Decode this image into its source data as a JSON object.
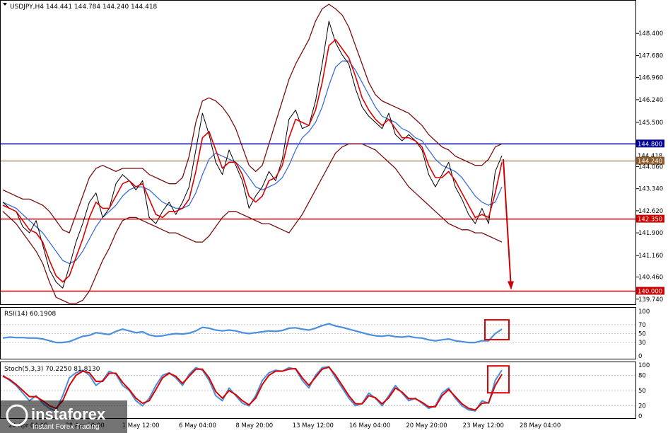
{
  "header": {
    "main": "USDJPY,H4  144.441 144.784 144.240 144.418",
    "rsi": "RSI(14) 60.1908",
    "stoch": "Stoch(5,3,3) 70.2250 81.8130"
  },
  "colors": {
    "price": "#000000",
    "ma_fast": "#dd0000",
    "ma_slow": "#3b6fd9",
    "bollinger": "#7a0f0f",
    "resistance": "#000099",
    "support": "#cc0000",
    "current": "#8b5a2b",
    "oscillator_blue": "#4a8fdc",
    "oscillator_red": "#dd0000",
    "highlight_box": "#dd0000"
  },
  "chart_data": [
    {
      "type": "line",
      "name": "USDJPY H4 price",
      "y_range": [
        139.62,
        149.35
      ],
      "y_ticks": [
        "148.400",
        "147.680",
        "146.960",
        "146.240",
        "145.500",
        "144.060",
        "143.340",
        "142.620",
        "141.900",
        "141.160",
        "140.460",
        "139.740"
      ],
      "x_labels": [
        "24 Apr 04:00",
        "28 Apr 20:00",
        "1 May 12:00",
        "6 May 04:00",
        "8 May 20:00",
        "13 May 12:00",
        "16 May 04:00",
        "20 May 20:00",
        "23 May 12:00",
        "28 May 04:00"
      ],
      "price": [
        142.9,
        142.7,
        142.6,
        142.1,
        141.9,
        142.3,
        141.5,
        140.7,
        140.3,
        140.1,
        140.8,
        141.6,
        142.2,
        142.9,
        143.2,
        142.4,
        142.7,
        143.5,
        143.8,
        143.6,
        143.3,
        143.6,
        142.4,
        142.2,
        142.6,
        142.9,
        142.5,
        142.9,
        143.4,
        144.6,
        145.8,
        145.1,
        144.2,
        143.8,
        144.6,
        144.1,
        143.6,
        142.7,
        143.1,
        143.4,
        143.9,
        143.6,
        144.3,
        145.6,
        145.9,
        145.3,
        145.4,
        146.2,
        147.4,
        148.8,
        148.1,
        147.7,
        147.4,
        146.6,
        146.0,
        145.7,
        145.5,
        145.3,
        145.8,
        145.1,
        144.9,
        145.1,
        144.9,
        144.6,
        143.8,
        143.4,
        143.8,
        144.2,
        143.4,
        143.0,
        142.5,
        142.2,
        142.7,
        142.2,
        143.9,
        144.418
      ],
      "ma_fast": [
        142.8,
        142.7,
        142.6,
        142.3,
        142.0,
        141.9,
        141.6,
        141.0,
        140.5,
        140.3,
        140.5,
        141.1,
        141.7,
        142.4,
        142.9,
        142.7,
        142.7,
        143.1,
        143.5,
        143.6,
        143.4,
        143.5,
        143.0,
        142.5,
        142.4,
        142.6,
        142.6,
        142.7,
        143.0,
        143.9,
        145.0,
        145.2,
        144.6,
        144.0,
        144.2,
        144.2,
        143.8,
        143.1,
        142.9,
        143.1,
        143.6,
        143.7,
        144.1,
        145.0,
        145.6,
        145.5,
        145.4,
        145.9,
        146.8,
        148.0,
        148.2,
        147.9,
        147.6,
        147.0,
        146.3,
        145.9,
        145.6,
        145.4,
        145.6,
        145.3,
        145.0,
        145.0,
        144.9,
        144.7,
        144.1,
        143.7,
        143.7,
        143.9,
        143.6,
        143.2,
        142.8,
        142.4,
        142.5,
        142.4,
        143.2,
        144.2
      ],
      "ma_slow": [
        142.9,
        142.8,
        142.7,
        142.5,
        142.3,
        142.1,
        141.9,
        141.6,
        141.3,
        141.0,
        140.9,
        141.0,
        141.3,
        141.7,
        142.1,
        142.4,
        142.6,
        142.8,
        143.1,
        143.3,
        143.4,
        143.4,
        143.3,
        143.1,
        142.9,
        142.8,
        142.7,
        142.7,
        142.8,
        143.2,
        143.8,
        144.3,
        144.5,
        144.4,
        144.3,
        144.2,
        144.0,
        143.7,
        143.4,
        143.3,
        143.4,
        143.5,
        143.7,
        144.1,
        144.6,
        145.0,
        145.2,
        145.5,
        146.0,
        146.7,
        147.3,
        147.5,
        147.5,
        147.2,
        146.8,
        146.4,
        146.0,
        145.7,
        145.6,
        145.5,
        145.3,
        145.2,
        145.0,
        144.9,
        144.6,
        144.3,
        144.1,
        144.0,
        143.9,
        143.7,
        143.4,
        143.1,
        142.9,
        142.8,
        142.9,
        143.4
      ],
      "bb_upper": [
        143.3,
        143.2,
        143.1,
        143.0,
        143.0,
        142.9,
        142.8,
        142.6,
        142.3,
        142.0,
        141.9,
        142.5,
        143.1,
        143.7,
        144.0,
        144.1,
        144.0,
        143.9,
        144.0,
        144.0,
        144.0,
        144.0,
        143.8,
        143.7,
        143.6,
        143.5,
        143.5,
        143.7,
        144.4,
        145.5,
        146.2,
        146.3,
        146.2,
        146.0,
        145.7,
        145.3,
        144.7,
        144.1,
        143.9,
        144.1,
        144.8,
        145.5,
        146.2,
        146.9,
        147.4,
        147.8,
        148.2,
        148.8,
        149.2,
        149.35,
        149.2,
        149.0,
        148.6,
        148.0,
        147.4,
        146.8,
        146.4,
        146.2,
        146.1,
        146.0,
        145.9,
        145.8,
        145.6,
        145.4,
        145.1,
        144.9,
        144.7,
        144.6,
        144.4,
        144.3,
        144.2,
        144.1,
        144.1,
        144.3,
        144.7,
        144.8
      ],
      "bb_lower": [
        142.6,
        142.4,
        142.2,
        141.9,
        141.6,
        141.3,
        140.9,
        140.3,
        139.8,
        139.7,
        139.6,
        139.6,
        139.7,
        140.0,
        140.5,
        141.0,
        141.4,
        141.9,
        142.3,
        142.4,
        142.4,
        142.3,
        142.2,
        142.1,
        142.0,
        141.9,
        141.9,
        141.8,
        141.7,
        141.6,
        141.6,
        141.8,
        142.1,
        142.4,
        142.6,
        142.6,
        142.5,
        142.4,
        142.3,
        142.2,
        142.2,
        142.1,
        142.0,
        141.9,
        142.2,
        142.5,
        142.9,
        143.3,
        143.7,
        144.1,
        144.5,
        144.7,
        144.8,
        144.8,
        144.8,
        144.7,
        144.6,
        144.4,
        144.2,
        144.0,
        143.7,
        143.4,
        143.2,
        143.0,
        142.8,
        142.6,
        142.4,
        142.2,
        142.1,
        142.0,
        142.0,
        141.9,
        141.9,
        141.8,
        141.7,
        141.6
      ],
      "forecast": [
        144.3,
        140.0
      ],
      "levels": [
        {
          "value": 144.8,
          "label": "144.800",
          "role": "resistance"
        },
        {
          "value": 144.418,
          "label": "144.418",
          "role": "bid"
        },
        {
          "value": 144.24,
          "label": "144.240",
          "role": "current"
        },
        {
          "value": 142.35,
          "label": "142.350",
          "role": "support"
        },
        {
          "value": 140.0,
          "label": "140.000",
          "role": "support"
        }
      ]
    },
    {
      "type": "line",
      "name": "RSI(14)",
      "y_range": [
        0,
        100
      ],
      "y_ticks": [
        "100",
        "70",
        "50",
        "30",
        "0"
      ],
      "values": [
        40,
        42,
        41,
        41,
        40,
        40,
        38,
        34,
        30,
        30,
        32,
        38,
        44,
        46,
        52,
        50,
        48,
        55,
        60,
        56,
        52,
        54,
        47,
        44,
        45,
        48,
        50,
        49,
        51,
        56,
        64,
        62,
        58,
        56,
        58,
        56,
        52,
        50,
        52,
        54,
        56,
        55,
        57,
        62,
        63,
        60,
        58,
        62,
        68,
        72,
        67,
        64,
        60,
        56,
        52,
        48,
        45,
        44,
        46,
        43,
        42,
        44,
        41,
        40,
        36,
        34,
        36,
        38,
        34,
        32,
        30,
        30,
        34,
        34,
        50,
        60.19
      ]
    },
    {
      "type": "line",
      "name": "Stoch(5,3,3)",
      "y_range": [
        0,
        100
      ],
      "y_ticks": [
        "100",
        "80",
        "50",
        "20",
        "0"
      ],
      "k": [
        80,
        70,
        60,
        45,
        30,
        40,
        25,
        15,
        10,
        40,
        75,
        85,
        90,
        80,
        60,
        70,
        88,
        82,
        60,
        50,
        30,
        20,
        35,
        60,
        80,
        85,
        75,
        60,
        82,
        95,
        90,
        70,
        40,
        30,
        55,
        40,
        25,
        20,
        40,
        70,
        85,
        90,
        88,
        95,
        92,
        70,
        55,
        80,
        95,
        97,
        75,
        55,
        35,
        20,
        25,
        45,
        35,
        20,
        40,
        60,
        45,
        30,
        35,
        25,
        15,
        20,
        45,
        55,
        35,
        20,
        12,
        10,
        30,
        25,
        70,
        90
      ],
      "d": [
        78,
        72,
        62,
        50,
        38,
        38,
        30,
        20,
        15,
        30,
        60,
        80,
        88,
        85,
        68,
        68,
        84,
        84,
        66,
        52,
        35,
        25,
        30,
        52,
        75,
        84,
        78,
        64,
        78,
        92,
        92,
        75,
        48,
        35,
        50,
        42,
        30,
        22,
        35,
        62,
        80,
        88,
        88,
        92,
        93,
        75,
        60,
        76,
        92,
        96,
        80,
        60,
        40,
        24,
        24,
        40,
        36,
        24,
        36,
        55,
        47,
        34,
        34,
        27,
        18,
        18,
        40,
        52,
        38,
        24,
        15,
        12,
        25,
        26,
        60,
        81.8
      ]
    }
  ]
}
